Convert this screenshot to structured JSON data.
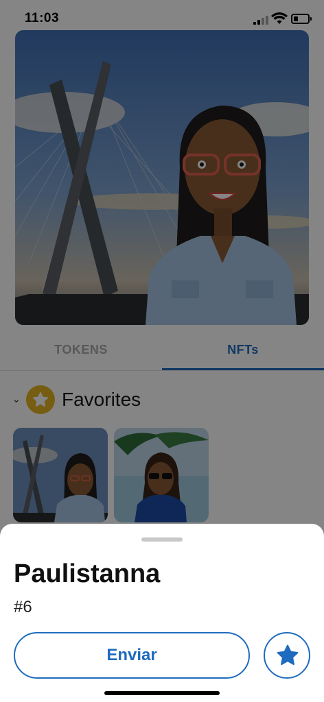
{
  "status_bar": {
    "time": "11:03",
    "icons": [
      "signal-icon",
      "wifi-icon",
      "battery-icon"
    ]
  },
  "tabs": [
    {
      "label": "TOKENS",
      "active": false
    },
    {
      "label": "NFTs",
      "active": true
    }
  ],
  "favorites": {
    "title": "Favorites",
    "icons": [
      "chevron-down-icon",
      "star-icon"
    ]
  },
  "sheet": {
    "name": "Paulistanna",
    "number": "#6",
    "send_label": "Enviar",
    "favorite_icon": "star-icon"
  },
  "colors": {
    "accent": "#1e6bbf",
    "star_badge": "#e2b322",
    "tab_inactive": "#a9a9a9"
  }
}
